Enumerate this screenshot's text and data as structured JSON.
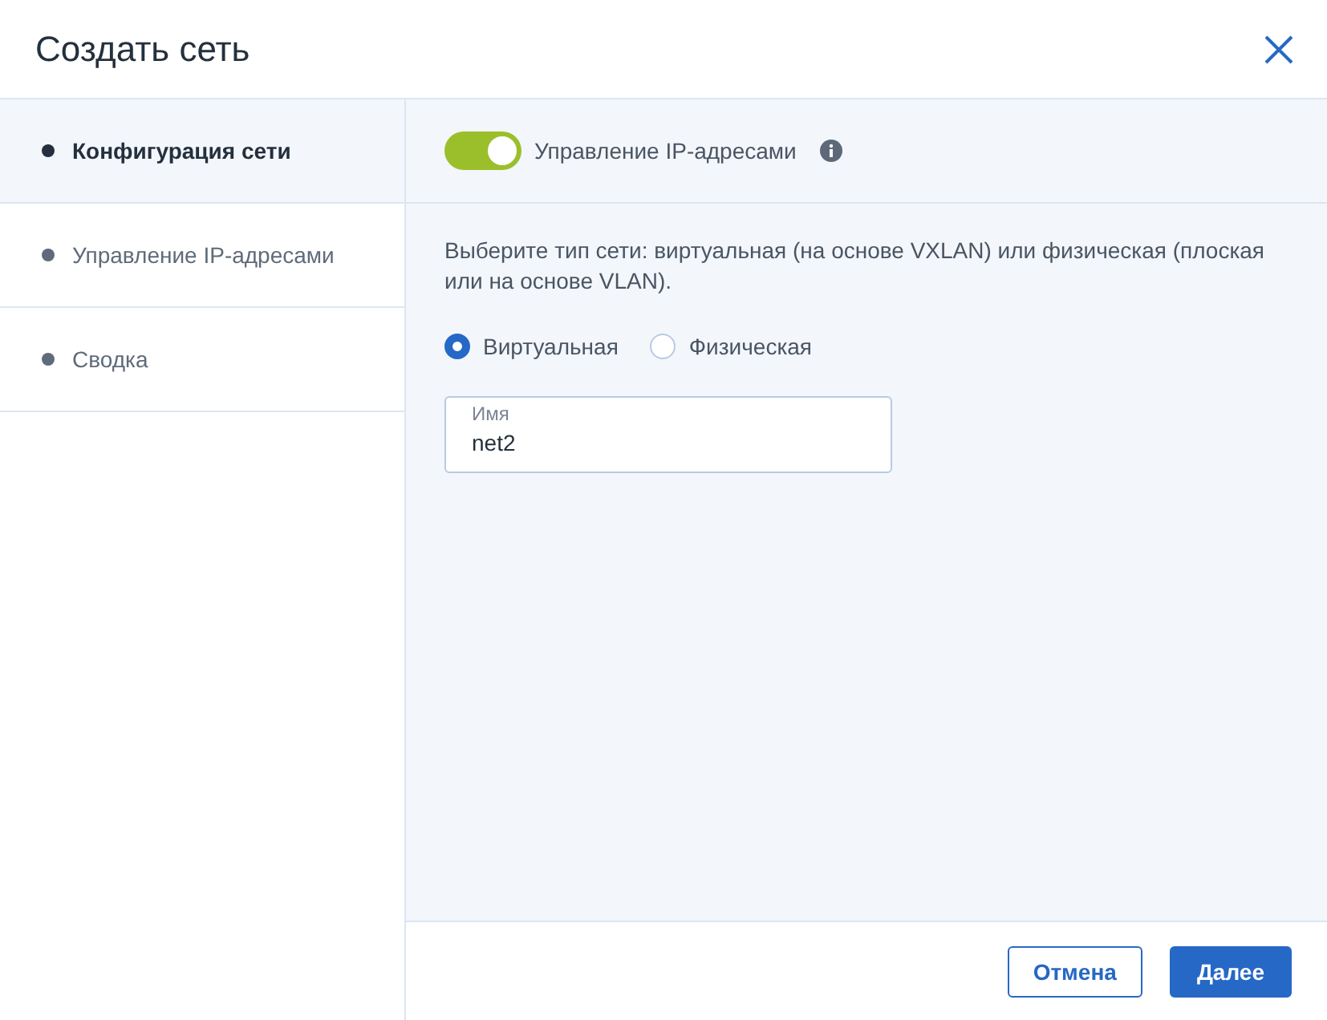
{
  "dialog": {
    "title": "Создать сеть"
  },
  "steps": [
    {
      "label": "Конфигурация сети",
      "selected": true
    },
    {
      "label": "Управление IP-адресами",
      "selected": false
    },
    {
      "label": "Сводка",
      "selected": false
    }
  ],
  "ip_management": {
    "label": "Управление IP-адресами",
    "on": true
  },
  "description": "Выберите тип сети: виртуальная (на основе VXLAN) или физическая (плоская или на основе VLAN).",
  "network_type": [
    {
      "label": "Виртуальная",
      "selected": true
    },
    {
      "label": "Физическая",
      "selected": false
    }
  ],
  "name_field": {
    "label": "Имя",
    "value": "net2"
  },
  "buttons": [
    {
      "label": "Отмена",
      "kind": "secondary"
    },
    {
      "label": "Далее",
      "kind": "primary"
    }
  ]
}
